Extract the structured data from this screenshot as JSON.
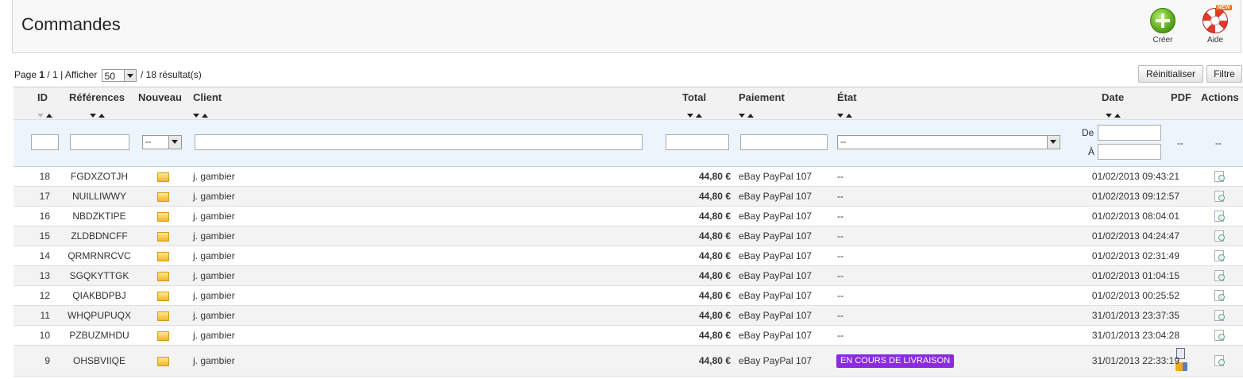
{
  "toolbar": {
    "title": "Commandes",
    "create_label": "Créer",
    "help_label": "Aide",
    "help_badge": "NEW"
  },
  "pager": {
    "page_text": "Page",
    "page_current": "1",
    "page_sep": " / 1 | Afficher",
    "per_page": "50",
    "results": "/ 18 résultat(s)"
  },
  "buttons": {
    "reset": "Réinitialiser",
    "filter": "Filtre"
  },
  "columns": {
    "id": "ID",
    "reference": "Références",
    "new": "Nouveau",
    "client": "Client",
    "total": "Total",
    "payment": "Paiement",
    "state": "État",
    "date": "Date",
    "pdf": "PDF",
    "actions": "Actions"
  },
  "filters": {
    "new_value": "--",
    "state_value": "--",
    "date_from_label": "De",
    "date_to_label": "À",
    "pdf_value": "--",
    "actions_value": "--"
  },
  "rows": [
    {
      "id": "18",
      "ref": "FGDXZOTJH",
      "client": "j. gambier",
      "total": "44,80 €",
      "payment": "eBay PayPal 107",
      "state": "--",
      "date": "01/02/2013 09:43:21"
    },
    {
      "id": "17",
      "ref": "NUILLIWWY",
      "client": "j. gambier",
      "total": "44,80 €",
      "payment": "eBay PayPal 107",
      "state": "--",
      "date": "01/02/2013 09:12:57"
    },
    {
      "id": "16",
      "ref": "NBDZKTIPE",
      "client": "j. gambier",
      "total": "44,80 €",
      "payment": "eBay PayPal 107",
      "state": "--",
      "date": "01/02/2013 08:04:01"
    },
    {
      "id": "15",
      "ref": "ZLDBDNCFF",
      "client": "j. gambier",
      "total": "44,80 €",
      "payment": "eBay PayPal 107",
      "state": "--",
      "date": "01/02/2013 04:24:47"
    },
    {
      "id": "14",
      "ref": "QRMRNRCVC",
      "client": "j. gambier",
      "total": "44,80 €",
      "payment": "eBay PayPal 107",
      "state": "--",
      "date": "01/02/2013 02:31:49"
    },
    {
      "id": "13",
      "ref": "SGQKYTTGK",
      "client": "j. gambier",
      "total": "44,80 €",
      "payment": "eBay PayPal 107",
      "state": "--",
      "date": "01/02/2013 01:04:15"
    },
    {
      "id": "12",
      "ref": "QIAKBDPBJ",
      "client": "j. gambier",
      "total": "44,80 €",
      "payment": "eBay PayPal 107",
      "state": "--",
      "date": "01/02/2013 00:25:52"
    },
    {
      "id": "11",
      "ref": "WHQPUPUQX",
      "client": "j. gambier",
      "total": "44,80 €",
      "payment": "eBay PayPal 107",
      "state": "--",
      "date": "31/01/2013 23:37:35"
    },
    {
      "id": "10",
      "ref": "PZBUZMHDU",
      "client": "j. gambier",
      "total": "44,80 €",
      "payment": "eBay PayPal 107",
      "state": "--",
      "date": "31/01/2013 23:04:28"
    },
    {
      "id": "9",
      "ref": "OHSBVIIQE",
      "client": "j. gambier",
      "total": "44,80 €",
      "payment": "eBay PayPal 107",
      "state": "EN COURS DE LIVRAISON",
      "state_color": "#8a2be2",
      "date": "31/01/2013 22:33:19"
    }
  ]
}
